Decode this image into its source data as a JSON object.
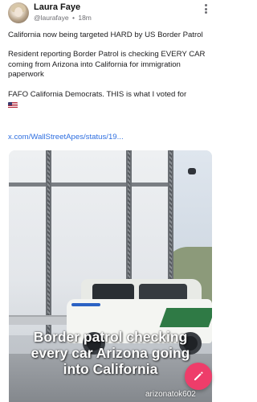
{
  "post": {
    "author_name": "Laura Faye",
    "author_handle": "@laurafaye",
    "separator": "•",
    "time_ago": "18m",
    "paragraphs": [
      "California now being targeted HARD by US Border Patrol",
      "Resident reporting Border Patrol is checking EVERY CAR coming from Arizona into California for immigration paperwork",
      "FAFO California Democrats. THIS is what I voted for"
    ],
    "link_text": "x.com/WallStreetApes/status/19...",
    "media": {
      "caption_lines": [
        "Border patrol checking",
        "every car Arizona going",
        "into California"
      ],
      "watermark": "arizonatok602"
    }
  },
  "icons": {
    "more": "more-options-icon",
    "flag": "us-flag-emoji",
    "compose": "compose-icon"
  },
  "colors": {
    "link": "#2f6fe0",
    "fab": "#ee3d6a"
  }
}
